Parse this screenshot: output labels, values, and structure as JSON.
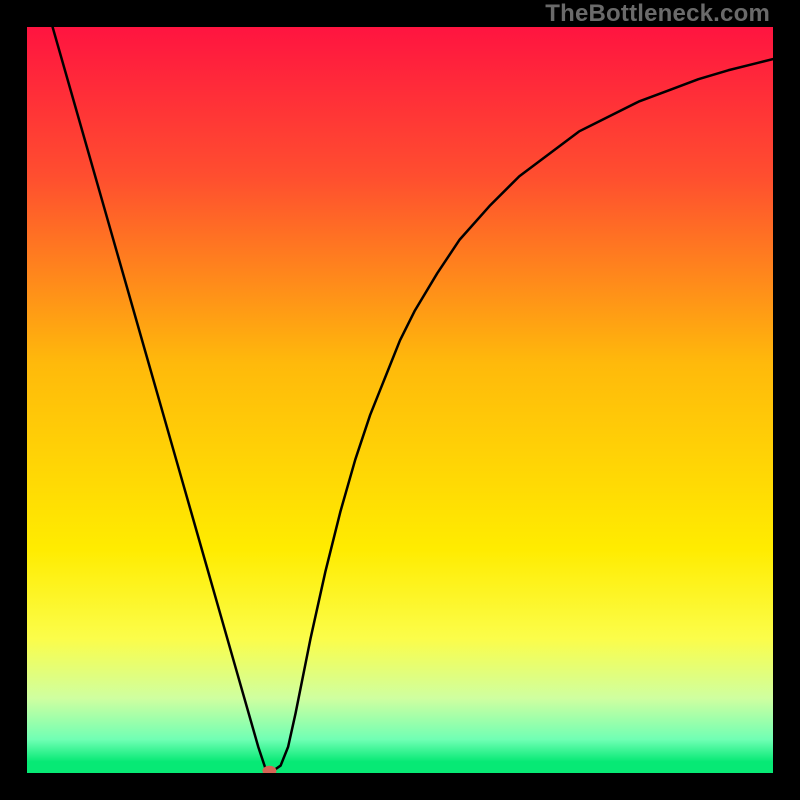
{
  "watermark": "TheBottleneck.com",
  "chart_data": {
    "type": "line",
    "title": "",
    "xlabel": "",
    "ylabel": "",
    "xlim": [
      0,
      100
    ],
    "ylim": [
      0,
      100
    ],
    "grid": false,
    "legend": false,
    "gradient_stops": [
      {
        "offset": 0.0,
        "color": "#ff1440"
      },
      {
        "offset": 0.2,
        "color": "#ff4e2f"
      },
      {
        "offset": 0.45,
        "color": "#ffb90b"
      },
      {
        "offset": 0.7,
        "color": "#ffec00"
      },
      {
        "offset": 0.82,
        "color": "#fbfd4a"
      },
      {
        "offset": 0.9,
        "color": "#cfffa0"
      },
      {
        "offset": 0.955,
        "color": "#70ffb4"
      },
      {
        "offset": 0.985,
        "color": "#07e975"
      },
      {
        "offset": 1.0,
        "color": "#07e975"
      }
    ],
    "series": [
      {
        "name": "bottleneck-curve",
        "stroke": "#000000",
        "x": [
          0,
          2,
          4,
          6,
          8,
          10,
          12,
          14,
          16,
          18,
          20,
          22,
          24,
          26,
          28,
          30,
          31,
          32,
          33,
          34,
          35,
          36,
          38,
          40,
          42,
          44,
          46,
          48,
          50,
          52,
          55,
          58,
          62,
          66,
          70,
          74,
          78,
          82,
          86,
          90,
          94,
          98,
          100
        ],
        "values": [
          112,
          105,
          98,
          91,
          84,
          77,
          70,
          63,
          56,
          49,
          42,
          35,
          28,
          21,
          14,
          7,
          3.5,
          0.5,
          0.3,
          1.0,
          3.5,
          8.0,
          18,
          27,
          35,
          42,
          48,
          53,
          58,
          62,
          67,
          71.5,
          76,
          80,
          83,
          86,
          88,
          90,
          91.5,
          93,
          94.2,
          95.2,
          95.7
        ]
      }
    ],
    "marker": {
      "name": "bottleneck-point",
      "x": 32.5,
      "y": 0.3,
      "rx": 7,
      "ry": 5,
      "fill": "#d66455"
    }
  }
}
